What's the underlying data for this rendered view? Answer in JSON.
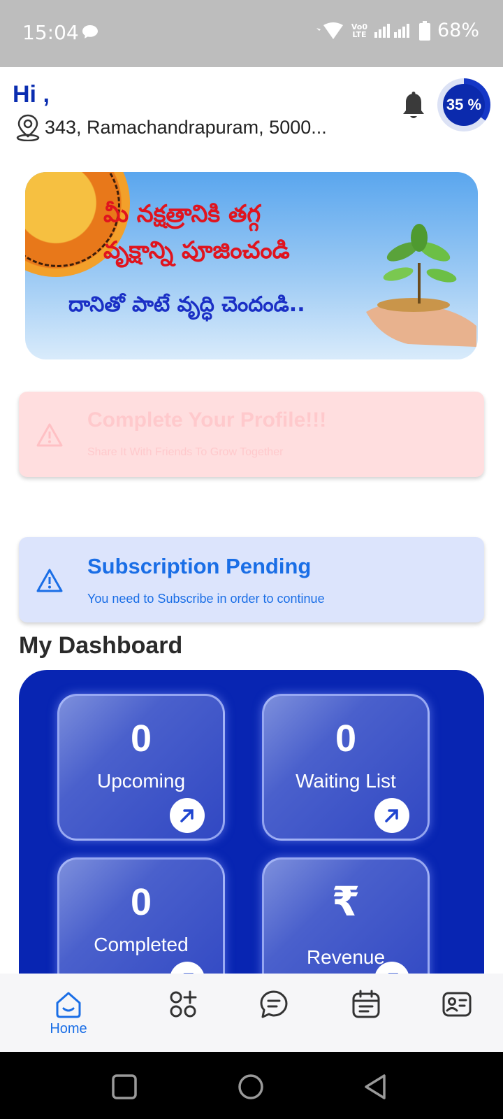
{
  "status_bar": {
    "time": "15:04",
    "battery": "68%",
    "volte_label": "Vo0 LTE"
  },
  "header": {
    "greeting": "Hi ,",
    "address": "343, Ramachandrapuram, 5000...",
    "profile_progress_text": "35 %",
    "profile_progress_value": 0.35
  },
  "banner": {
    "line1": "మీ నక్షత్రానికి తగ్గ",
    "line2": "వృక్షాన్ని పూజించండి",
    "line3": "దానితో పాటే వృద్ధి చెందండి.."
  },
  "profile_card": {
    "title": "Complete Your Profile!!!",
    "subtitle": "Share It With Friends To Grow Together"
  },
  "subscription_card": {
    "title": "Subscription Pending",
    "subtitle": "You need to Subscribe in order to continue"
  },
  "dashboard": {
    "title": "My Dashboard",
    "tiles": [
      {
        "value": "0",
        "label": "Upcoming"
      },
      {
        "value": "0",
        "label": "Waiting List"
      },
      {
        "value": "0",
        "label": "Completed"
      },
      {
        "value": "₹",
        "label": "Revenue"
      }
    ]
  },
  "bottom_nav": {
    "items": [
      {
        "label": "Home",
        "icon": "home-icon",
        "active": true
      },
      {
        "label": "",
        "icon": "apps-add-icon"
      },
      {
        "label": "",
        "icon": "chat-icon"
      },
      {
        "label": "",
        "icon": "calendar-icon"
      },
      {
        "label": "",
        "icon": "profile-card-icon"
      }
    ]
  },
  "colors": {
    "primary": "#0825b2",
    "accent": "#1a6ee6",
    "warning_bg": "#ffdedf",
    "info_bg": "#dce4fc"
  }
}
